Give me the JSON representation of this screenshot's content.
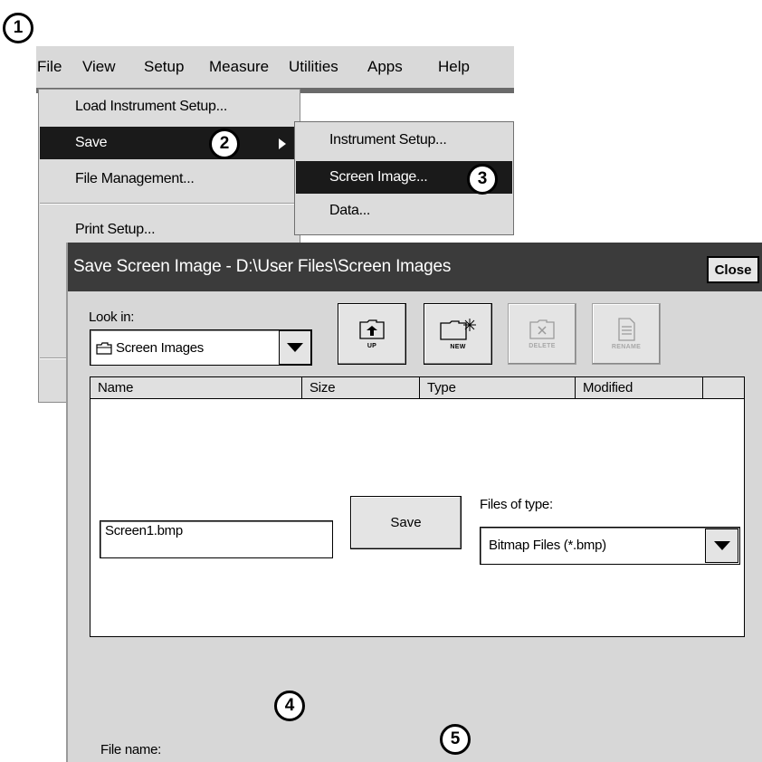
{
  "callouts": [
    "1",
    "2",
    "3",
    "4",
    "5"
  ],
  "menubar": {
    "items": [
      "File",
      "View",
      "Setup",
      "Measure",
      "Utilities",
      "Apps",
      "Help"
    ]
  },
  "file_menu": {
    "items": [
      "Load Instrument Setup...",
      "Save",
      "File Management...",
      "Print Setup..."
    ]
  },
  "save_submenu": {
    "items": [
      "Instrument Setup...",
      "Screen Image...",
      "Data..."
    ]
  },
  "dialog": {
    "title": "Save Screen Image - D:\\User Files\\Screen Images",
    "close_label": "Close",
    "look_in_label": "Look in:",
    "look_in_value": "Screen Images",
    "toolbar": {
      "up": "UP",
      "new": "NEW",
      "delete": "DELETE",
      "rename": "RENAME"
    },
    "columns": [
      "Name",
      "Size",
      "Type",
      "Modified"
    ],
    "file_name_label": "File name:",
    "file_name_value": "Screen1.bmp",
    "save_label": "Save",
    "files_of_type_label": "Files of type:",
    "files_of_type_value": "Bitmap Files (*.bmp)"
  }
}
